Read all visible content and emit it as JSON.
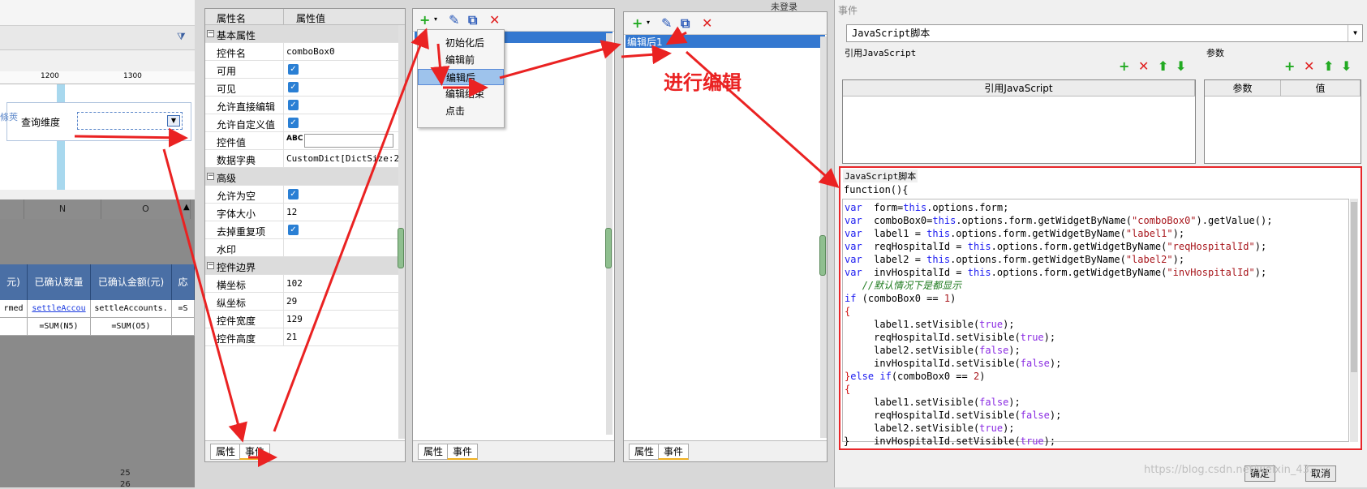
{
  "designer": {
    "ruler_marks": [
      "1200",
      "1300"
    ],
    "form_label": "查询维度",
    "side_label": "條莢",
    "col_headers": [
      "N",
      "O"
    ],
    "sheet_headers": [
      "元)",
      "已确认数量",
      "已确认金额(元)",
      "応"
    ],
    "row1": [
      "rmed",
      "settleAccou",
      "settleAccounts.",
      "=S"
    ],
    "row2": [
      "=SUM(N5)",
      "=SUM(O5)"
    ],
    "row_numbers": [
      "25",
      "26"
    ]
  },
  "props": {
    "head_name": "属性名",
    "head_value": "属性值",
    "rows": [
      {
        "type": "group",
        "label": "基本属性"
      },
      {
        "type": "text",
        "label": "控件名",
        "value": "comboBox0"
      },
      {
        "type": "check",
        "label": "可用"
      },
      {
        "type": "check",
        "label": "可见"
      },
      {
        "type": "check",
        "label": "允许直接编辑"
      },
      {
        "type": "check",
        "label": "允许自定义值"
      },
      {
        "type": "input",
        "label": "控件值"
      },
      {
        "type": "text",
        "label": "数据字典",
        "value": "CustomDict[DictSize:2]"
      },
      {
        "type": "group",
        "label": "高级"
      },
      {
        "type": "check",
        "label": "允许为空"
      },
      {
        "type": "text",
        "label": "字体大小",
        "value": "12"
      },
      {
        "type": "check",
        "label": "去掉重复项"
      },
      {
        "type": "text",
        "label": "水印",
        "value": ""
      },
      {
        "type": "group",
        "label": "控件边界"
      },
      {
        "type": "text",
        "label": "横坐标",
        "value": "102"
      },
      {
        "type": "text",
        "label": "纵坐标",
        "value": "29"
      },
      {
        "type": "text",
        "label": "控件宽度",
        "value": "129"
      },
      {
        "type": "text",
        "label": "控件高度",
        "value": "21"
      }
    ],
    "tabs": [
      "属性",
      "事件"
    ]
  },
  "events_list": {
    "menu": [
      "初始化后",
      "编辑前",
      "编辑后",
      "编辑结束",
      "点击"
    ],
    "tabs": [
      "属性",
      "事件"
    ]
  },
  "events_list2": {
    "selected": "编辑后1",
    "tabs": [
      "属性",
      "事件"
    ]
  },
  "annotation": "进行编辑",
  "top_label": "未登录",
  "dialog": {
    "title": "事件",
    "script_type": "JavaScript脚本",
    "ref_js_group": "引用JavaScript",
    "params_group": "参数",
    "ref_js_header": "引用JavaScript",
    "param_header": "参数",
    "value_header": "值",
    "script_group": "JavaScript脚本",
    "func_header": "function(){",
    "closing": "}",
    "ok": "确定",
    "cancel": "取消"
  },
  "watermark": "https://blog.csdn.net/weixin_43...",
  "colors": {
    "accent": "#3478d0",
    "annotation_red": "#ea2222",
    "add_green": "#22aa22",
    "delete_red": "#e02020"
  }
}
